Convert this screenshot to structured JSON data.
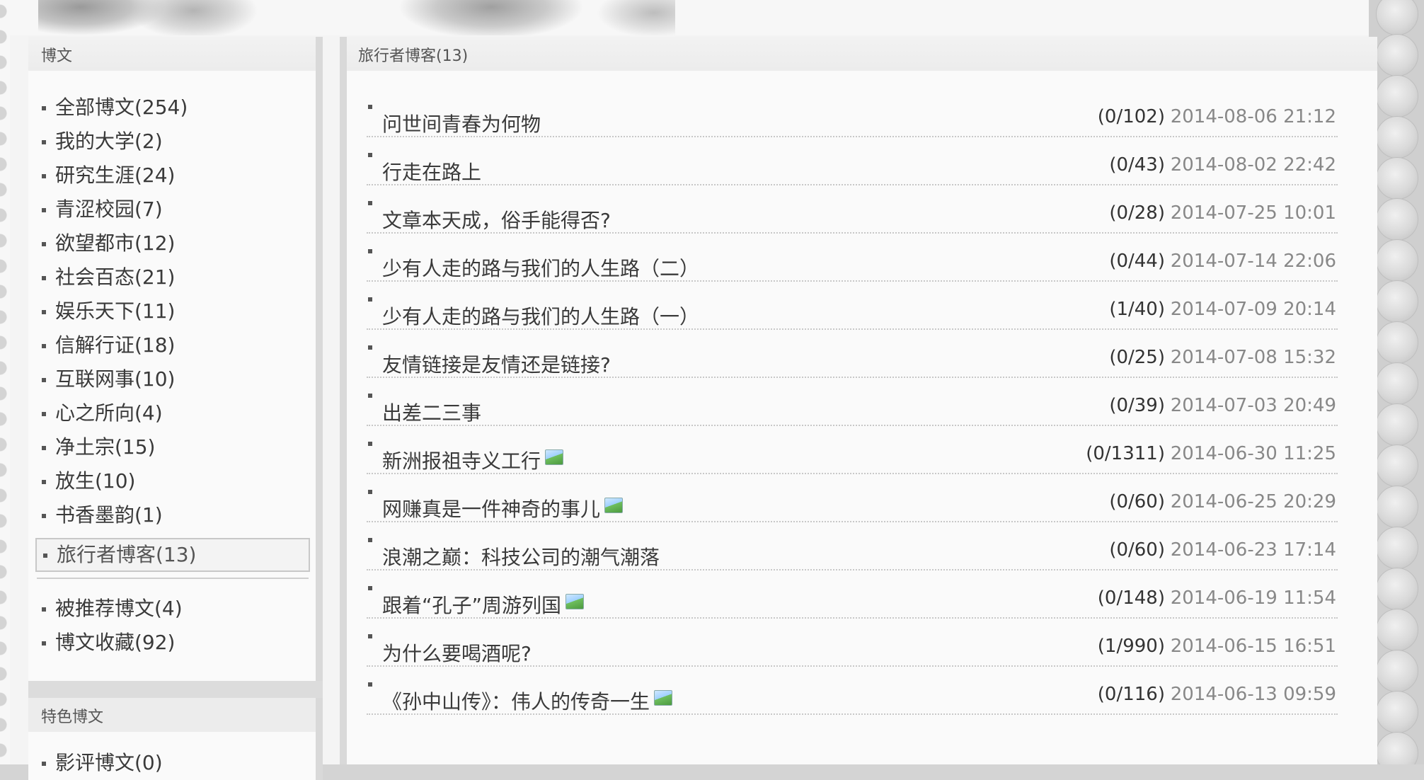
{
  "sidebar": {
    "heading": "博文",
    "categories": [
      {
        "label": "全部博文(254)"
      },
      {
        "label": "我的大学(2)"
      },
      {
        "label": "研究生涯(24)"
      },
      {
        "label": "青涩校园(7)"
      },
      {
        "label": "欲望都市(12)"
      },
      {
        "label": "社会百态(21)"
      },
      {
        "label": "娱乐天下(11)"
      },
      {
        "label": "信解行证(18)"
      },
      {
        "label": "互联网事(10)"
      },
      {
        "label": "心之所向(4)"
      },
      {
        "label": "净土宗(15)"
      },
      {
        "label": "放生(10)"
      },
      {
        "label": "书香墨韵(1)"
      }
    ],
    "active_category": {
      "label": "旅行者博客(13)"
    },
    "extra_items": [
      {
        "label": "被推荐博文(4)"
      },
      {
        "label": "博文收藏(92)"
      }
    ],
    "featured_heading": "特色博文",
    "featured_items": [
      {
        "label": "影评博文(0)"
      }
    ]
  },
  "main": {
    "heading": "旅行者博客(13)",
    "posts": [
      {
        "title": "问世间青春为何物",
        "count": "(0/102)",
        "date": "2014-08-06 21:12",
        "has_image": false
      },
      {
        "title": "行走在路上",
        "count": "(0/43)",
        "date": "2014-08-02 22:42",
        "has_image": false
      },
      {
        "title": "文章本天成，俗手能得否?",
        "count": "(0/28)",
        "date": "2014-07-25 10:01",
        "has_image": false
      },
      {
        "title": "少有人走的路与我们的人生路（二）",
        "count": "(0/44)",
        "date": "2014-07-14 22:06",
        "has_image": false
      },
      {
        "title": "少有人走的路与我们的人生路（一）",
        "count": "(1/40)",
        "date": "2014-07-09 20:14",
        "has_image": false
      },
      {
        "title": "友情链接是友情还是链接?",
        "count": "(0/25)",
        "date": "2014-07-08 15:32",
        "has_image": false
      },
      {
        "title": "出差二三事",
        "count": "(0/39)",
        "date": "2014-07-03 20:49",
        "has_image": false
      },
      {
        "title": "新洲报祖寺义工行",
        "count": "(0/1311)",
        "date": "2014-06-30 11:25",
        "has_image": true
      },
      {
        "title": "网赚真是一件神奇的事儿",
        "count": "(0/60)",
        "date": "2014-06-25 20:29",
        "has_image": true
      },
      {
        "title": "浪潮之巅：科技公司的潮气潮落",
        "count": "(0/60)",
        "date": "2014-06-23 17:14",
        "has_image": false
      },
      {
        "title": "跟着“孔子”周游列国",
        "count": "(0/148)",
        "date": "2014-06-19 11:54",
        "has_image": true
      },
      {
        "title": "为什么要喝酒呢?",
        "count": "(1/990)",
        "date": "2014-06-15 16:51",
        "has_image": false
      },
      {
        "title": "《孙中山传》：伟人的传奇一生",
        "count": "(0/116)",
        "date": "2014-06-13 09:59",
        "has_image": true
      }
    ]
  },
  "image_icon": "image-icon"
}
